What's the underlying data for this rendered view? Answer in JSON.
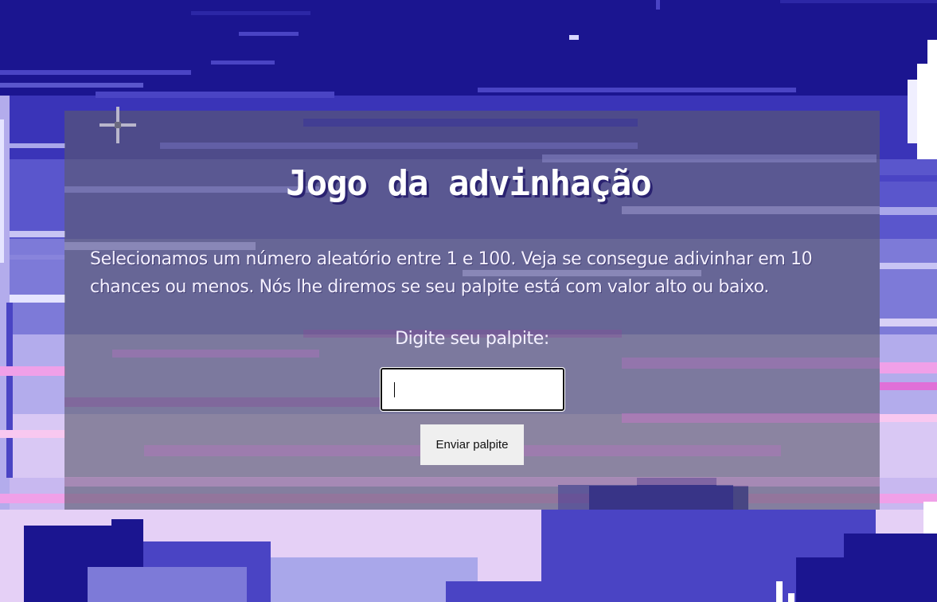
{
  "game": {
    "title": "Jogo da advinhação",
    "description": "Selecionamos um número aleatório entre 1 e 100. Veja se consegue adivinhar em 10 chances ou menos. Nós lhe diremos se seu palpite está com valor alto ou baixo.",
    "guess_label": "Digite seu palpite:",
    "guess_value": "",
    "submit_label": "Enviar palpite"
  },
  "colors": {
    "sky_dark": "#1b1590",
    "sky_mid": "#4a44c4",
    "sky_light": "#a9a7ea",
    "pink": "#e070d8",
    "panel_overlay": "rgba(90,90,110,0.62)",
    "text": "#ffffff"
  },
  "icons": {
    "sparkle": "sparkle-icon",
    "moon": "moon-icon"
  }
}
